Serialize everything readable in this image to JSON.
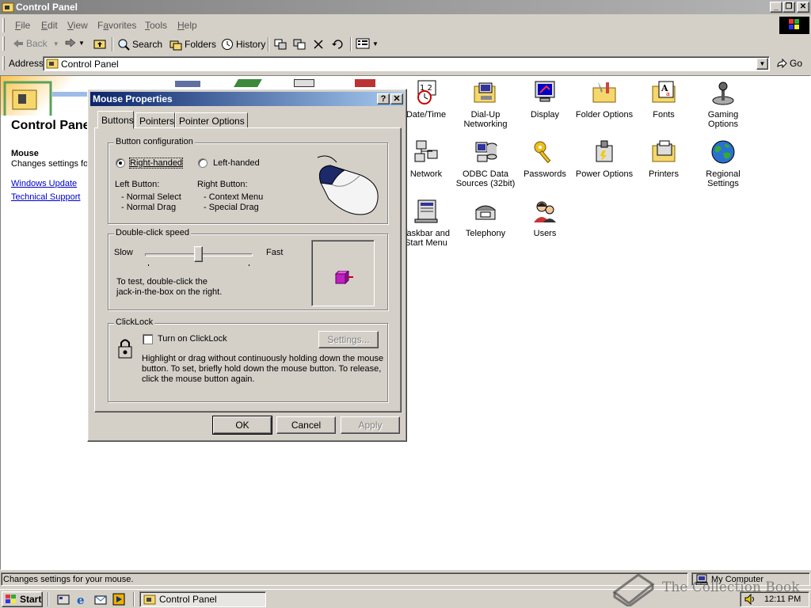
{
  "window": {
    "title": "Control Panel"
  },
  "menu": {
    "items": [
      {
        "label": "File",
        "key": "F",
        "rest": "ile"
      },
      {
        "label": "Edit",
        "key": "E",
        "rest": "dit"
      },
      {
        "label": "View",
        "key": "V",
        "rest": "iew"
      },
      {
        "label": "Favorites",
        "key": "F",
        "rest": "a",
        "after": "vorites"
      },
      {
        "label": "Tools",
        "key": "T",
        "rest": "ools"
      },
      {
        "label": "Help",
        "key": "H",
        "rest": "elp"
      }
    ]
  },
  "toolbar": {
    "back": "Back",
    "search": "Search",
    "folders": "Folders",
    "history": "History"
  },
  "address": {
    "label": "Address",
    "value": "Control Panel",
    "go": "Go"
  },
  "left_pane": {
    "title": "Control Panel",
    "selected_title": "Mouse",
    "selected_desc": "Changes settings for your mouse.",
    "links": [
      "Windows Update",
      "Technical Support"
    ]
  },
  "icons": [
    {
      "label": "Date/Time",
      "icon": "datetime-icon"
    },
    {
      "label": "Dial-Up Networking",
      "icon": "dialup-icon"
    },
    {
      "label": "Display",
      "icon": "display-icon"
    },
    {
      "label": "Folder Options",
      "icon": "folder-options-icon"
    },
    {
      "label": "Fonts",
      "icon": "fonts-icon"
    },
    {
      "label": "Gaming Options",
      "icon": "gaming-icon"
    },
    {
      "label": "Network",
      "icon": "network-icon"
    },
    {
      "label": "ODBC Data Sources (32bit)",
      "icon": "odbc-icon"
    },
    {
      "label": "Passwords",
      "icon": "passwords-icon"
    },
    {
      "label": "Power Options",
      "icon": "power-icon"
    },
    {
      "label": "Printers",
      "icon": "printers-icon"
    },
    {
      "label": "Regional Settings",
      "icon": "regional-icon"
    },
    {
      "label": "Taskbar and Start Menu",
      "icon": "taskbar-icon"
    },
    {
      "label": "Telephony",
      "icon": "telephony-icon"
    },
    {
      "label": "Users",
      "icon": "users-icon"
    }
  ],
  "dialog": {
    "title": "Mouse Properties",
    "tabs": [
      "Buttons",
      "Pointers",
      "Pointer Options"
    ],
    "button_config": {
      "label": "Button configuration",
      "right_handed": "Right-handed",
      "left_handed": "Left-handed",
      "selected": "right",
      "left_button_title": "Left Button:",
      "left_button_items": [
        "- Normal Select",
        "- Normal Drag"
      ],
      "right_button_title": "Right Button:",
      "right_button_items": [
        "- Context Menu",
        "- Special Drag"
      ]
    },
    "double_click": {
      "label": "Double-click speed",
      "slow": "Slow",
      "fast": "Fast",
      "level": 0.5,
      "test_text_1": "To test, double-click the",
      "test_text_2": "jack-in-the-box on the right."
    },
    "clicklock": {
      "label": "ClickLock",
      "checkbox_label": "Turn on ClickLock",
      "checked": false,
      "settings_button": "Settings...",
      "desc_1": "Highlight or drag without continuously holding down the mouse",
      "desc_2": "button. To set, briefly hold down the mouse button. To release,",
      "desc_3": "click the mouse button again."
    },
    "buttons": {
      "ok": "OK",
      "cancel": "Cancel",
      "apply": "Apply"
    }
  },
  "status": {
    "text": "Changes settings for your mouse.",
    "zone": "My Computer"
  },
  "taskbar": {
    "start": "Start",
    "task": "Control Panel",
    "clock": "12:11 PM"
  },
  "watermark": "The Collection Book"
}
